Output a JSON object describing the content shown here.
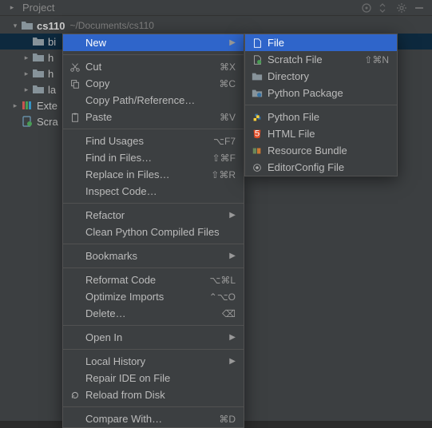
{
  "toolbar": {
    "title": "Project"
  },
  "tree": {
    "project": {
      "name": "cs110",
      "path": "~/Documents/cs110"
    },
    "items": [
      "bi",
      "h",
      "h",
      "la"
    ],
    "ext": "Exte",
    "scratch": "Scra"
  },
  "ctx": {
    "new": "New",
    "cut": {
      "label": "Cut",
      "sc": "⌘X"
    },
    "copy": {
      "label": "Copy",
      "sc": "⌘C"
    },
    "copy_path": "Copy Path/Reference…",
    "paste": {
      "label": "Paste",
      "sc": "⌘V"
    },
    "find_usages": {
      "label": "Find Usages",
      "sc": "⌥F7"
    },
    "find_in_files": {
      "label": "Find in Files…",
      "sc": "⇧⌘F"
    },
    "replace_in_files": {
      "label": "Replace in Files…",
      "sc": "⇧⌘R"
    },
    "inspect": "Inspect Code…",
    "refactor": "Refactor",
    "clean_python": "Clean Python Compiled Files",
    "bookmarks": "Bookmarks",
    "reformat": {
      "label": "Reformat Code",
      "sc": "⌥⌘L"
    },
    "optimize": {
      "label": "Optimize Imports",
      "sc": "⌃⌥O"
    },
    "delete": {
      "label": "Delete…",
      "sc": "⌫"
    },
    "open_in": "Open In",
    "local_history": "Local History",
    "repair": "Repair IDE on File",
    "reload": "Reload from Disk",
    "compare": {
      "label": "Compare With…",
      "sc": "⌘D"
    }
  },
  "sub": {
    "file": "File",
    "scratch": {
      "label": "Scratch File",
      "sc": "⇧⌘N"
    },
    "directory": "Directory",
    "python_pkg": "Python Package",
    "python_file": "Python File",
    "html_file": "HTML File",
    "resource": "Resource Bundle",
    "editorconfig": "EditorConfig File"
  }
}
